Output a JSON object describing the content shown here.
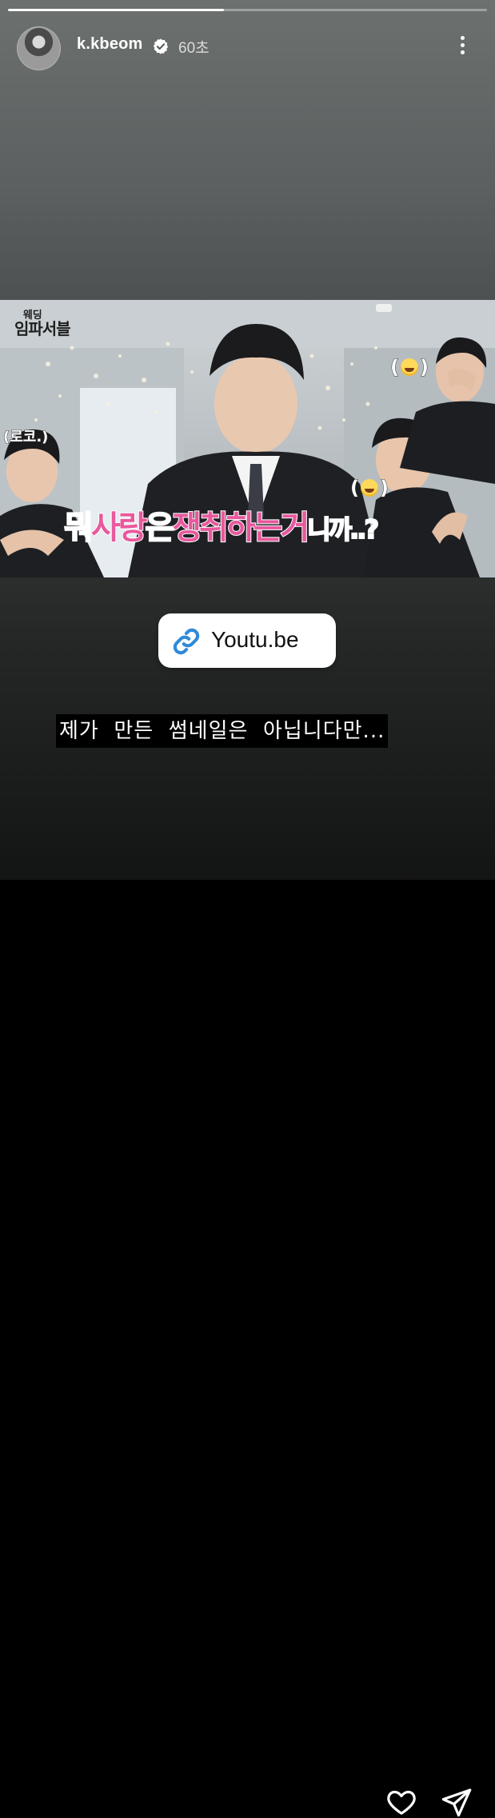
{
  "story": {
    "progress": 0.45,
    "username": "k.kbeom",
    "verified": true,
    "time": "60초",
    "link_sticker": {
      "label": "Youtu.be",
      "icon": "link-icon"
    },
    "text_overlay": "제가  만든  썸네일은  아닙니다만..."
  },
  "thumbnail": {
    "logo_small": "웨딩",
    "logo_big": "임파서블",
    "caption_left": "(로코.)",
    "subtitle_parts": [
      "뭐",
      "사랑",
      "은",
      "쟁취하는",
      "거",
      "니까..?"
    ],
    "emoji_tag_top": "rolling-on-floor-laughing emoji",
    "emoji_tag_mid": "tears-of-joy emoji"
  },
  "footer": {
    "like_icon": "heart-icon",
    "share_icon": "send-icon"
  },
  "colors": {
    "accent_pink": "#e8599d",
    "link_blue": "#2f8ad8"
  }
}
